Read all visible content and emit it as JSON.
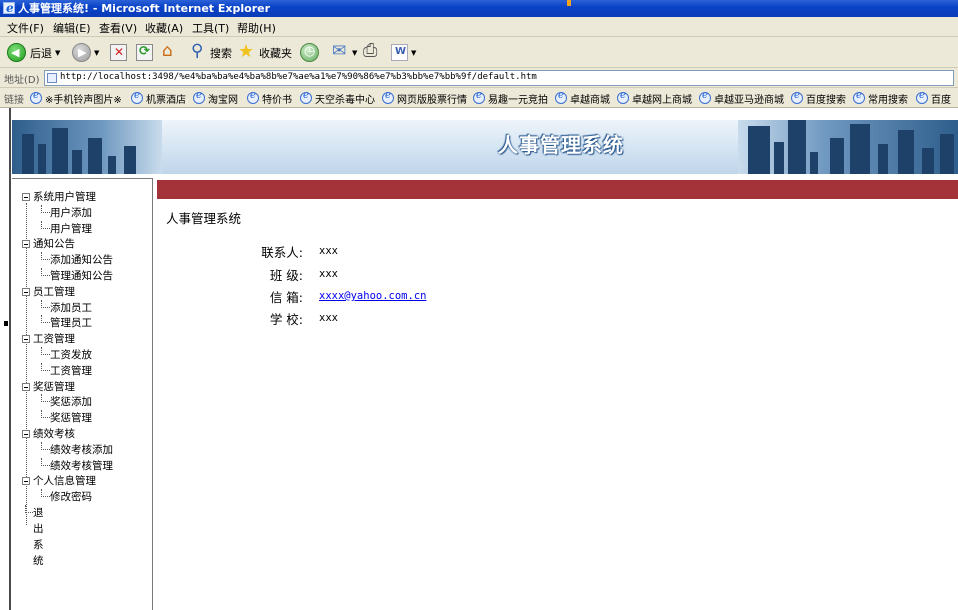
{
  "window": {
    "title": "人事管理系统! - Microsoft Internet Explorer"
  },
  "menu": [
    "文件(F)",
    "编辑(E)",
    "查看(V)",
    "收藏(A)",
    "工具(T)",
    "帮助(H)"
  ],
  "toolbar": {
    "back": "后退",
    "search": "搜索",
    "favorites": "收藏夹"
  },
  "address": {
    "label": "地址(D)",
    "url": "http://localhost:3498/%e4%ba%ba%e4%ba%8b%e7%ae%a1%e7%90%86%e7%b3%bb%e7%bb%9f/default.htm"
  },
  "links": {
    "label": "链接",
    "items": [
      "※手机铃声图片※",
      "机票酒店",
      "淘宝网",
      "特价书",
      "天空杀毒中心",
      "网页版股票行情",
      "易趣一元竞拍",
      "卓越商城",
      "卓越网上商城",
      "卓越亚马逊商城",
      "百度搜索",
      "常用搜索",
      "百度"
    ]
  },
  "banner": {
    "title": "人事管理系统"
  },
  "tree": [
    {
      "label": "系统用户管理",
      "children": [
        "用户添加",
        "用户管理"
      ]
    },
    {
      "label": "通知公告",
      "children": [
        "添加通知公告",
        "管理通知公告"
      ]
    },
    {
      "label": "员工管理",
      "children": [
        "添加员工",
        "管理员工"
      ]
    },
    {
      "label": "工资管理",
      "children": [
        "工资发放",
        "工资管理"
      ]
    },
    {
      "label": "奖惩管理",
      "children": [
        "奖惩添加",
        "奖惩管理"
      ]
    },
    {
      "label": "绩效考核",
      "children": [
        "绩效考核添加",
        "绩效考核管理"
      ]
    },
    {
      "label": "个人信息管理",
      "children": [
        "修改密码"
      ]
    }
  ],
  "tree_exit": "退出系统",
  "content": {
    "title": "人事管理系统",
    "contact_label": "联系人:",
    "contact_value": "xxx",
    "class_label": "班 级:",
    "class_value": "xxx",
    "email_label": "信 箱:",
    "email_value": "xxxx@yahoo.com.cn",
    "school_label": "学 校:",
    "school_value": "xxx"
  }
}
